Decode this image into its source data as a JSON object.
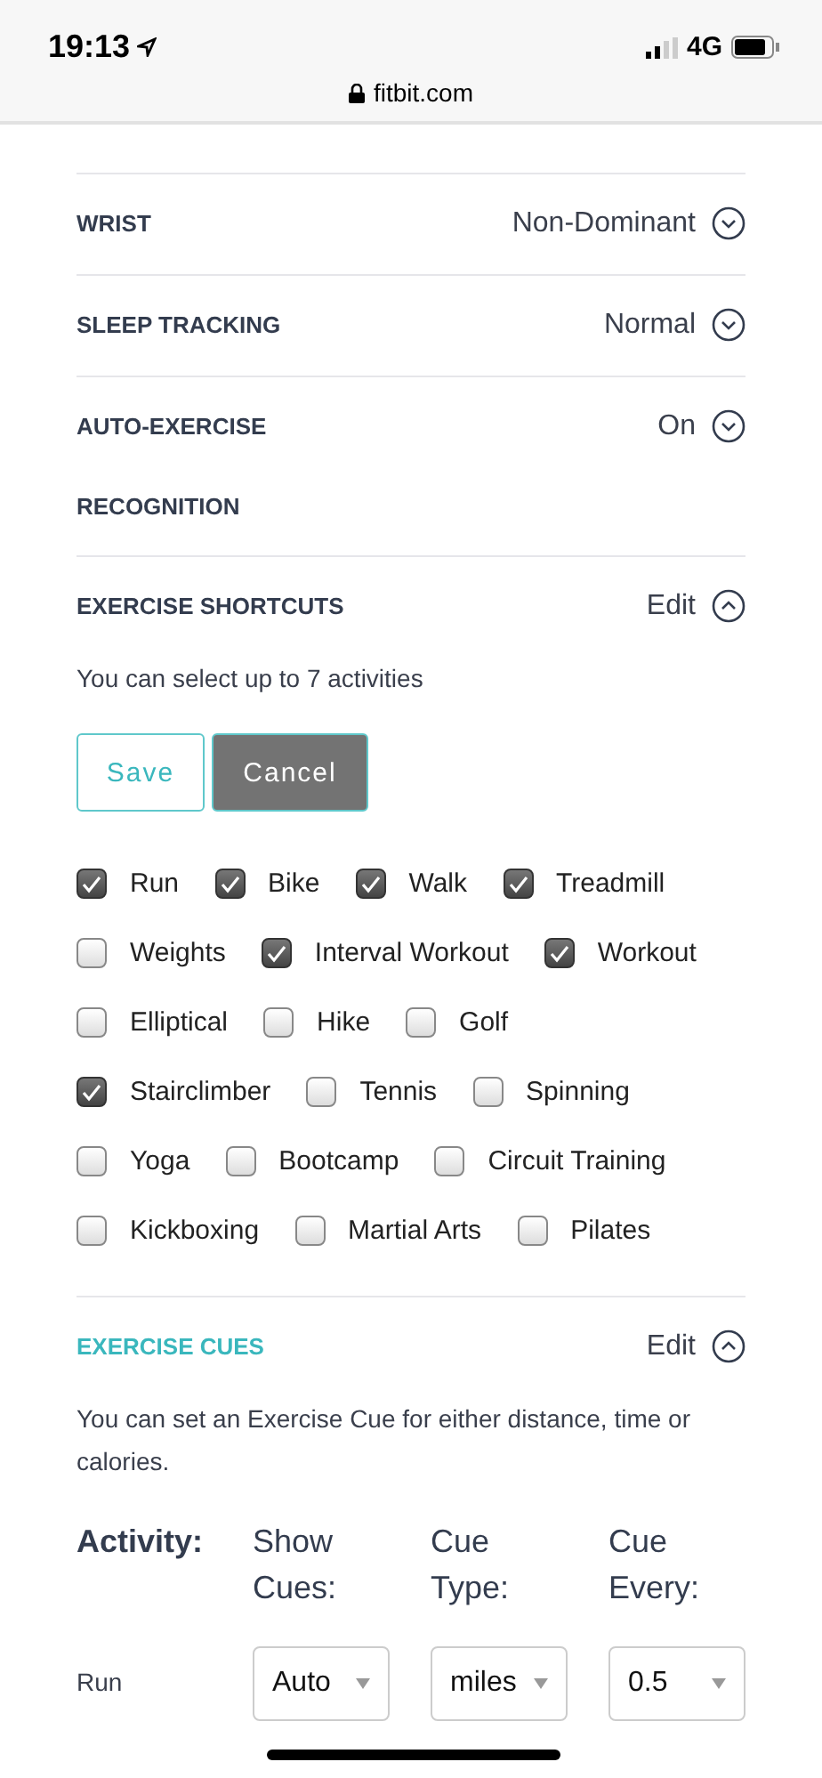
{
  "status_bar": {
    "time": "19:13",
    "network": "4G",
    "url": "fitbit.com"
  },
  "settings": [
    {
      "label": "WRIST",
      "value": "Non-Dominant",
      "expanded": false
    },
    {
      "label": "SLEEP TRACKING",
      "value": "Normal",
      "expanded": false
    },
    {
      "label": "AUTO-EXERCISE RECOGNITION",
      "value": "On",
      "expanded": false
    }
  ],
  "shortcuts": {
    "label": "EXERCISE SHORTCUTS",
    "highlighted": false,
    "action": "Edit",
    "expanded": true,
    "description": "You can select up to 7 activities",
    "buttons": [
      {
        "label": "Save",
        "kind": "outline"
      },
      {
        "label": "Cancel",
        "kind": "filled"
      }
    ],
    "activity_rows": [
      [
        {
          "label": "Run",
          "checked": true
        },
        {
          "label": "Bike",
          "checked": true
        },
        {
          "label": "Walk",
          "checked": true
        },
        {
          "label": "Treadmill",
          "checked": true
        }
      ],
      [
        {
          "label": "Weights",
          "checked": false
        },
        {
          "label": "Interval Workout",
          "checked": true
        },
        {
          "label": "Workout",
          "checked": true
        }
      ],
      [
        {
          "label": "Elliptical",
          "checked": false
        },
        {
          "label": "Hike",
          "checked": false
        },
        {
          "label": "Golf",
          "checked": false
        }
      ],
      [
        {
          "label": "Stairclimber",
          "checked": true
        },
        {
          "label": "Tennis",
          "checked": false
        },
        {
          "label": "Spinning",
          "checked": false
        }
      ],
      [
        {
          "label": "Yoga",
          "checked": false
        },
        {
          "label": "Bootcamp",
          "checked": false
        },
        {
          "label": "Circuit Training",
          "checked": false
        }
      ],
      [
        {
          "label": "Kickboxing",
          "checked": false
        },
        {
          "label": "Martial Arts",
          "checked": false
        },
        {
          "label": "Pilates",
          "checked": false
        }
      ]
    ]
  },
  "cues": {
    "label": "EXERCISE CUES",
    "highlighted": true,
    "action": "Edit",
    "expanded": true,
    "description": "You can set an Exercise Cue for either distance, time or calories.",
    "columns": [
      "Activity:",
      "Show Cues:",
      "Cue Type:",
      "Cue Every:"
    ],
    "rows": [
      {
        "activity": "Run",
        "show_cues": "Auto",
        "cue_type": "miles",
        "cue_every": "0.5"
      }
    ]
  }
}
